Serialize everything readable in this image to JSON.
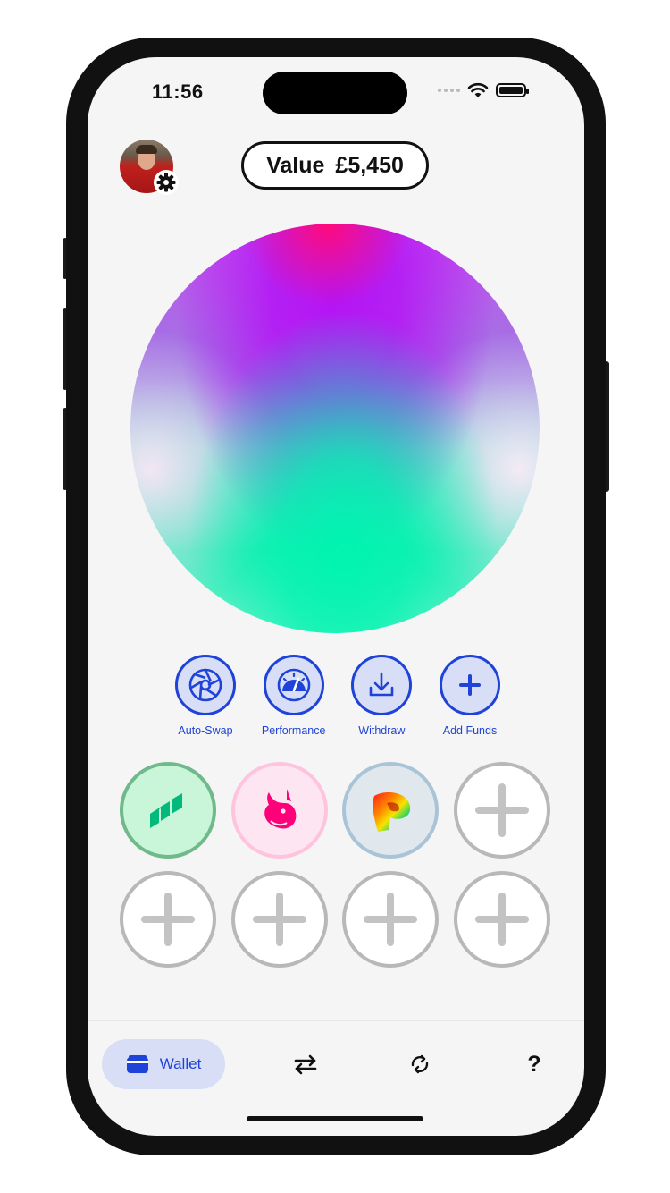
{
  "status": {
    "time": "11:56"
  },
  "header": {
    "value_label": "Value",
    "value_amount": "£5,450",
    "avatar_icon": "profile-avatar",
    "settings_icon": "gear-icon"
  },
  "actions": [
    {
      "label": "Auto-Swap",
      "icon": "aperture-icon"
    },
    {
      "label": "Performance",
      "icon": "speedometer-icon"
    },
    {
      "label": "Withdraw",
      "icon": "download-tray-icon"
    },
    {
      "label": "Add Funds",
      "icon": "plus-icon"
    }
  ],
  "tokens": [
    {
      "name": "compound",
      "icon": "compound-logo"
    },
    {
      "name": "uniswap",
      "icon": "uniswap-unicorn-logo"
    },
    {
      "name": "curve",
      "icon": "curve-logo"
    },
    {
      "name": "add-token",
      "icon": "plus-icon"
    },
    {
      "name": "add-token",
      "icon": "plus-icon"
    },
    {
      "name": "add-token",
      "icon": "plus-icon"
    },
    {
      "name": "add-token",
      "icon": "plus-icon"
    },
    {
      "name": "add-token",
      "icon": "plus-icon"
    }
  ],
  "tabbar": {
    "wallet_label": "Wallet",
    "help_label": "?",
    "icons": [
      "wallet-icon",
      "swap-arrows-icon",
      "refresh-icon",
      "help-icon"
    ]
  },
  "colors": {
    "accent": "#1f43d8",
    "accent_bg": "#d7def5",
    "background": "#f5f5f5"
  }
}
